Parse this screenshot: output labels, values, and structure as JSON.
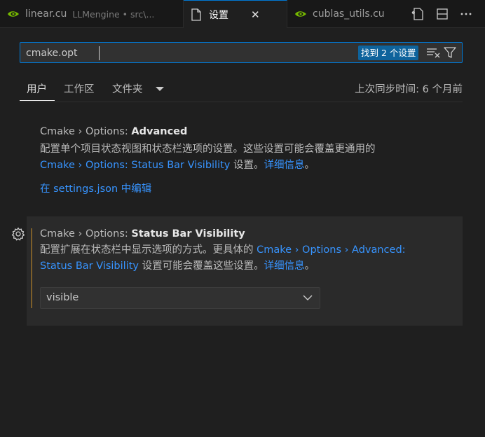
{
  "tabs": [
    {
      "label": "linear.cu",
      "description": "LLMengine • src\\..."
    },
    {
      "label": "设置",
      "close": "✕"
    },
    {
      "label": "cublas_utils.cu"
    }
  ],
  "search": {
    "value": "cmake.opt",
    "placeholder": "",
    "results_badge": "找到 2 个设置"
  },
  "scope_tabs": {
    "user": "用户",
    "workspace": "工作区",
    "folder": "文件夹",
    "sync_status": "上次同步时间: 6 个月前"
  },
  "settings": [
    {
      "title_prefix": "Cmake › Options: ",
      "title_name": "Advanced",
      "desc_line1": "配置单个项目状态视图和状态栏选项的设置。这些设置可能会覆盖更通用的",
      "desc_link": "Cmake › Options: Status Bar Visibility",
      "desc_after": " 设置。",
      "more_info": "详细信息",
      "end": "。",
      "edit_link": "在 settings.json 中编辑"
    },
    {
      "title_prefix": "Cmake › Options: ",
      "title_name": "Status Bar Visibility",
      "desc_before": "配置扩展在状态栏中显示选项的方式。更具体的 ",
      "desc_link_1": "Cmake › Options › Advanced:",
      "desc_link_2": "Status Bar Visibility",
      "desc_after": " 设置可能会覆盖这些设置。",
      "more_info": "详细信息",
      "end": "。",
      "selected_value": "visible"
    }
  ],
  "colors": {
    "accent": "#0078d4",
    "link": "#3794ff",
    "badge": "#0e639c",
    "modified": "#7c5e2a"
  }
}
